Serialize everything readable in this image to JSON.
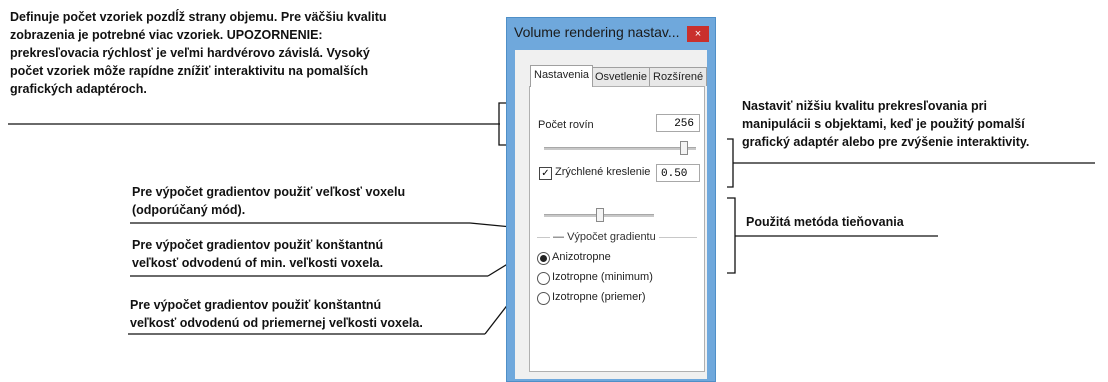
{
  "annotations": {
    "slices": [
      "Definuje počet vzoriek pozdĺž strany objemu. Pre väčšiu kvalitu",
      "zobrazenia je potrebné viac vzoriek. UPOZORNENIE:",
      "prekresľovacia rýchlosť je veľmi hardvérovo závislá. Vysoký",
      "počet vzoriek môže rapídne znížiť interaktivitu na pomalších",
      "grafických adaptéroch."
    ],
    "fast_rendering": [
      "Nastaviť nižšiu kvalitu prekresľovania pri",
      "manipulácii s objektami, keď je použitý pomalší",
      "grafický adaptér alebo pre zvýšenie interaktivity."
    ],
    "anisotropic": [
      "Pre výpočet gradientov použiť veľkosť voxelu",
      "(odporúčaný mód)."
    ],
    "isotropic_min": [
      "Pre výpočet gradientov použiť konštantnú",
      "veľkosť odvodenú of min. veľkosti voxela."
    ],
    "isotropic_avg": [
      "Pre výpočet gradientov použiť konštantnú",
      "veľkosť odvodenú od priemernej veľkosti voxela."
    ],
    "shading": [
      "Použitá metóda tieňovania"
    ]
  },
  "dialog": {
    "title": "Volume rendering nastav...",
    "close_glyph": "×",
    "tabs": [
      "Nastavenia",
      "Osvetlenie",
      "Rozšírené"
    ],
    "slice_count_label": "Počet rovín",
    "slice_count_value": "256",
    "slice_slider_level": 0.93,
    "fast_draw_label": "Zrýchlené kreslenie",
    "fast_draw_checked": true,
    "fast_draw_check_glyph": "✓",
    "fast_draw_value": "0.50",
    "fast_draw_slider_level": 0.5,
    "gradient_group_label": "Výpočet gradientu",
    "gradient_options": [
      "Anizotropne",
      "Izotropne (minimum)",
      "Izotropne (priemer)"
    ],
    "gradient_selected": "Anizotropne"
  }
}
